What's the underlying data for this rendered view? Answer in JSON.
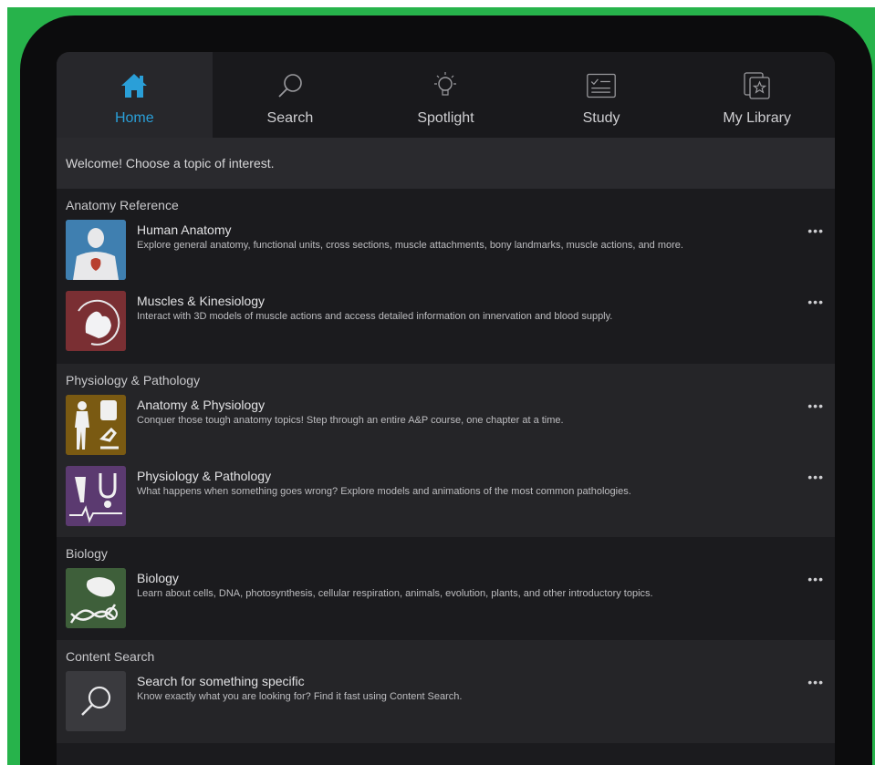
{
  "tabs": [
    {
      "label": "Home",
      "icon": "home-icon",
      "active": true
    },
    {
      "label": "Search",
      "icon": "search-icon",
      "active": false
    },
    {
      "label": "Spotlight",
      "icon": "lightbulb-icon",
      "active": false
    },
    {
      "label": "Study",
      "icon": "checklist-icon",
      "active": false
    },
    {
      "label": "My Library",
      "icon": "library-star-icon",
      "active": false
    }
  ],
  "welcome": "Welcome! Choose a topic of interest.",
  "sections": [
    {
      "title": "Anatomy Reference",
      "items": [
        {
          "title": "Human Anatomy",
          "desc": "Explore general anatomy, functional units, cross sections, muscle attachments, bony landmarks, muscle actions, and more.",
          "more": "•••"
        },
        {
          "title": "Muscles & Kinesiology",
          "desc": "Interact with 3D models of muscle actions and access detailed information on innervation and blood supply.",
          "more": "•••"
        }
      ]
    },
    {
      "title": "Physiology & Pathology",
      "items": [
        {
          "title": "Anatomy & Physiology",
          "desc": "Conquer those tough anatomy topics! Step through an entire A&P course, one chapter at a time.",
          "more": "•••"
        },
        {
          "title": "Physiology & Pathology",
          "desc": "What happens when something goes wrong? Explore models and animations of the most common pathologies.",
          "more": "•••"
        }
      ]
    },
    {
      "title": "Biology",
      "items": [
        {
          "title": "Biology",
          "desc": "Learn about cells, DNA, photosynthesis, cellular respiration, animals, evolution, plants, and other introductory topics.",
          "more": "•••"
        }
      ]
    },
    {
      "title": "Content Search",
      "items": [
        {
          "title": "Search for something specific",
          "desc": "Know exactly what you are looking for? Find it fast using Content Search.",
          "more": "•••"
        }
      ]
    }
  ],
  "colors": {
    "frame": "#27b34b",
    "accent": "#2a9fd8",
    "thumb_human_anatomy": "#3f7fb0",
    "thumb_muscles": "#7a2f33",
    "thumb_ap": "#7a5a12",
    "thumb_physpath": "#5b3a70",
    "thumb_biology": "#3e5f3a",
    "thumb_search": "#3a3a3e"
  }
}
